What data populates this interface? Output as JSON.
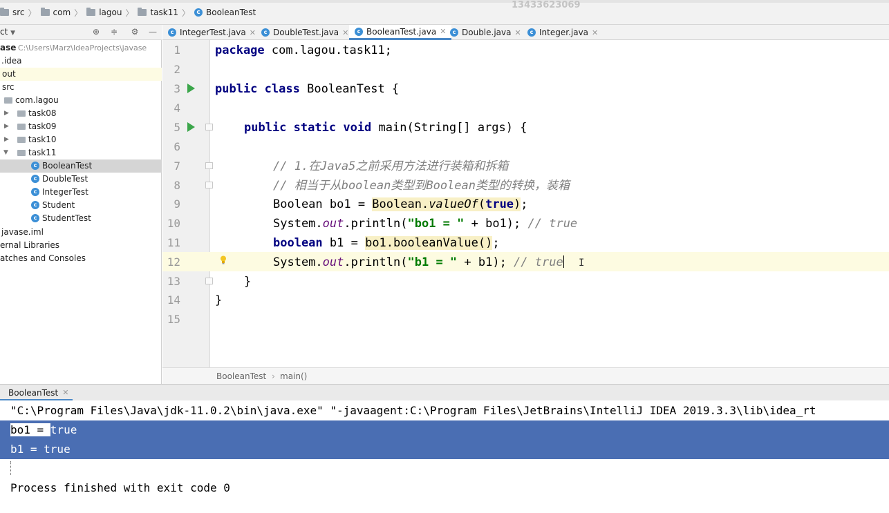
{
  "breadcrumb": {
    "items": [
      "src",
      "com",
      "lagou",
      "task11",
      "BooleanTest"
    ]
  },
  "watermark": "13433623069",
  "project_panel": {
    "title": "ct",
    "tree": [
      {
        "label": "ase",
        "path": "C:\\Users\\Marz\\IdeaProjects\\javase",
        "kind": "module",
        "bold": true
      },
      {
        "label": ".idea",
        "kind": "folder"
      },
      {
        "label": "out",
        "kind": "folder"
      },
      {
        "label": "src",
        "kind": "folder"
      },
      {
        "label": "com.lagou",
        "kind": "package"
      },
      {
        "label": "task08",
        "kind": "package"
      },
      {
        "label": "task09",
        "kind": "package"
      },
      {
        "label": "task10",
        "kind": "package"
      },
      {
        "label": "task11",
        "kind": "package"
      },
      {
        "label": "BooleanTest",
        "kind": "class"
      },
      {
        "label": "DoubleTest",
        "kind": "class"
      },
      {
        "label": "IntegerTest",
        "kind": "class"
      },
      {
        "label": "Student",
        "kind": "class"
      },
      {
        "label": "StudentTest",
        "kind": "class"
      },
      {
        "label": "javase.iml",
        "kind": "file"
      },
      {
        "label": "ernal Libraries",
        "kind": "lib"
      },
      {
        "label": "atches and Consoles",
        "kind": "lib"
      }
    ]
  },
  "editor_tabs": [
    {
      "label": "IntegerTest.java",
      "active": false
    },
    {
      "label": "DoubleTest.java",
      "active": false
    },
    {
      "label": "BooleanTest.java",
      "active": true
    },
    {
      "label": "Double.java",
      "active": false
    },
    {
      "label": "Integer.java",
      "active": false
    }
  ],
  "code": {
    "line_numbers": [
      "1",
      "2",
      "3",
      "4",
      "5",
      "6",
      "7",
      "8",
      "9",
      "10",
      "11",
      "12",
      "13",
      "14",
      "15"
    ],
    "l1": {
      "kw": "package",
      "rest": " com.lagou.task11;"
    },
    "l3": {
      "kw1": "public",
      "kw2": "class",
      "rest": " BooleanTest {"
    },
    "l5": {
      "kw1": "public",
      "kw2": "static",
      "kw3": "void",
      "rest": " main(String[] args) {"
    },
    "l7": "// 1.在Java5之前采用方法进行装箱和拆箱",
    "l8": "// 相当于从boolean类型到Boolean类型的转换，装箱",
    "l9": {
      "pre": "Boolean bo1 = ",
      "cls": "Boolean.",
      "method": "valueOf",
      "open": "(",
      "kw": "true",
      "close": ")",
      "end": ";"
    },
    "l10": {
      "pre": "System.",
      "field": "out",
      "mid": ".println(",
      "str": "\"bo1 = \"",
      "post": " + bo1); ",
      "cmt": "// true"
    },
    "l11": {
      "kw": "boolean",
      "pre": " b1 = ",
      "hl": "bo1.booleanValue()",
      "end": ";"
    },
    "l12": {
      "pre": "System.",
      "field": "out",
      "mid": ".println(",
      "str": "\"b1 = \"",
      "post": " + b1); ",
      "cmt": "// true"
    },
    "l13": "}",
    "l14": "}"
  },
  "editor_breadcrumb": {
    "cls": "BooleanTest",
    "method": "main()"
  },
  "run_tab": {
    "label": "BooleanTest"
  },
  "console": {
    "cmd": "\"C:\\Program Files\\Java\\jdk-11.0.2\\bin\\java.exe\" \"-javaagent:C:\\Program Files\\JetBrains\\IntelliJ IDEA 2019.3.3\\lib\\idea_rt",
    "out1_prefix": "bo1 = ",
    "out1_value": "true",
    "out2": "b1 = true",
    "exit": "Process finished with exit code 0"
  }
}
